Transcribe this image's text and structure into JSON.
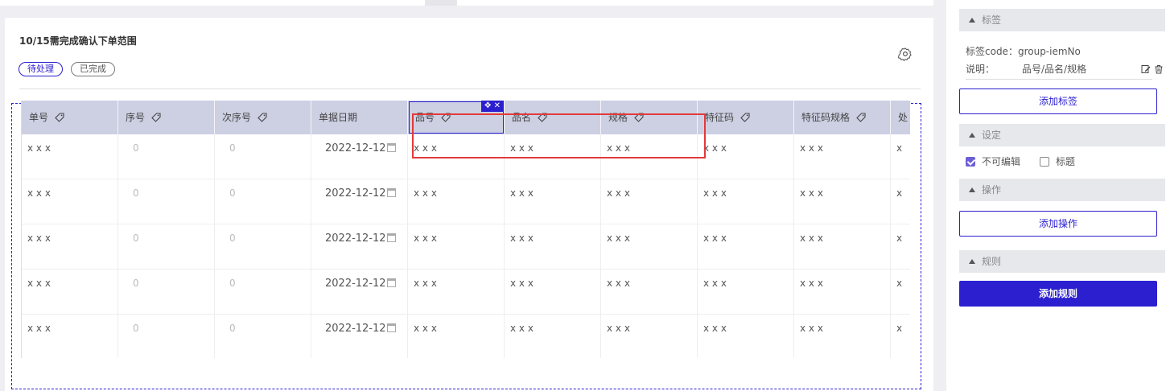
{
  "page": {
    "title": "10/15需完成确认下单范围",
    "chips": [
      {
        "label": "待处理",
        "active": true
      },
      {
        "label": "已完成",
        "active": false
      }
    ]
  },
  "table": {
    "columns": [
      "单号",
      "序号",
      "次序号",
      "单据日期",
      "品号",
      "品名",
      "规格",
      "特征码",
      "特征码规格",
      "处"
    ],
    "selected_column": "品号",
    "rows": [
      {
        "no": "x x x",
        "seq": "0",
        "subseq": "0",
        "date": "2022-12-12",
        "item_no": "x x x",
        "item_name": "x x x",
        "spec": "x x x",
        "feature": "x x x",
        "feature_spec": "x x x",
        "extra": "x"
      },
      {
        "no": "x x x",
        "seq": "0",
        "subseq": "0",
        "date": "2022-12-12",
        "item_no": "x x x",
        "item_name": "x x x",
        "spec": "x x x",
        "feature": "x x x",
        "feature_spec": "x x x",
        "extra": "x"
      },
      {
        "no": "x x x",
        "seq": "0",
        "subseq": "0",
        "date": "2022-12-12",
        "item_no": "x x x",
        "item_name": "x x x",
        "spec": "x x x",
        "feature": "x x x",
        "feature_spec": "x x x",
        "extra": "x"
      },
      {
        "no": "x x x",
        "seq": "0",
        "subseq": "0",
        "date": "2022-12-12",
        "item_no": "x x x",
        "item_name": "x x x",
        "spec": "x x x",
        "feature": "x x x",
        "feature_spec": "x x x",
        "extra": "x"
      },
      {
        "no": "x x x",
        "seq": "0",
        "subseq": "0",
        "date": "2022-12-12",
        "item_no": "x x x",
        "item_name": "x x x",
        "spec": "x x x",
        "feature": "x x x",
        "feature_spec": "x x x",
        "extra": "x"
      }
    ]
  },
  "panel": {
    "tag_section": {
      "title": "标签"
    },
    "tag_code_label": "标签code：",
    "tag_code_value": "group-iemNo",
    "desc_label": "说明：",
    "desc_value": "品号/品名/规格",
    "add_tag": "添加标签",
    "settings_section": {
      "title": "设定"
    },
    "checkbox_readonly": {
      "label": "不可编辑",
      "checked": true
    },
    "checkbox_title": {
      "label": "标题",
      "checked": false
    },
    "ops_section": {
      "title": "操作"
    },
    "add_op": "添加操作",
    "rules_section": {
      "title": "规则"
    },
    "add_rule": "添加规则"
  },
  "colors": {
    "accent": "#2b1fd0",
    "header_bg": "#cdd0e3",
    "highlight": "#e23a3a"
  },
  "icons": [
    "gear-icon",
    "tag-icon",
    "move-icon",
    "close-icon",
    "calendar-icon",
    "edit-icon",
    "trash-icon",
    "caret-up-icon",
    "checkbox-checked-icon"
  ]
}
